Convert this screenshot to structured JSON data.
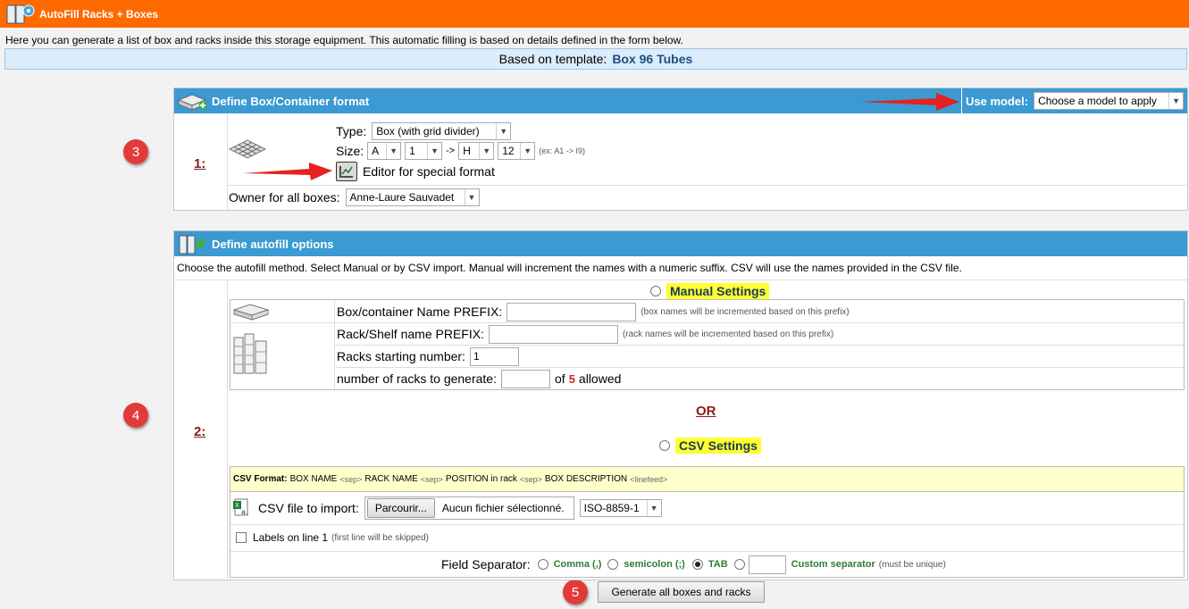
{
  "window": {
    "title": "AutoFill Racks + Boxes"
  },
  "intro": "Here you can generate a list of box and racks inside this storage equipment. This automatic filling is based on details defined in the form below.",
  "template": {
    "label": "Based on template:",
    "name": "Box 96 Tubes"
  },
  "section1": {
    "title": "Define Box/Container format",
    "use_model_label": "Use model:",
    "use_model_value": "Choose a model to apply",
    "step": "1:",
    "type_label": "Type:",
    "type_value": "Box (with grid divider)",
    "size_label": "Size:",
    "size_row_from": "A",
    "size_col_from": "1",
    "size_arrow": "->",
    "size_row_to": "H",
    "size_col_to": "12",
    "size_hint": "(ex: A1 -> I9)",
    "editor_label": "Editor for special format",
    "owner_label": "Owner for all boxes:",
    "owner_value": "Anne-Laure Sauvadet"
  },
  "section2": {
    "title": "Define autofill options",
    "description": "Choose the autofill method. Select Manual or by CSV import. Manual will increment the names with a numeric suffix. CSV will use the names provided in the CSV file.",
    "step": "2:",
    "manual_label": "Manual Settings",
    "box_prefix_label": "Box/container Name PREFIX:",
    "box_prefix_value": "",
    "box_prefix_hint": "(box names will be incremented based on this prefix)",
    "rack_prefix_label": "Rack/Shelf name PREFIX:",
    "rack_prefix_value": "",
    "rack_prefix_hint": "(rack names will be incremented based on this prefix)",
    "rack_start_label": "Racks starting number:",
    "rack_start_value": "1",
    "rack_count_label": "number of racks to generate:",
    "rack_count_value": "",
    "rack_count_of": "of",
    "rack_count_max": "5",
    "rack_count_allowed": "allowed",
    "or_label": "OR",
    "csv_label": "CSV Settings",
    "csv_format_label": "CSV Format:",
    "csv_format_1": "BOX NAME",
    "csv_sep": "<sep>",
    "csv_format_2": "RACK NAME",
    "csv_format_3": "POSITION in rack",
    "csv_format_4": "BOX DESCRIPTION",
    "csv_linefeed": "<linefeed>",
    "csv_file_label": "CSV file to import:",
    "browse_label": "Parcourir...",
    "no_file_label": "Aucun fichier sélectionné.",
    "encoding_value": "ISO-8859-1",
    "labels_line_label": "Labels on line 1",
    "labels_line_hint": "(first line will be skipped)",
    "separator_label": "Field Separator:",
    "sep_comma": "Comma (,)",
    "sep_semicolon": "semicolon (;)",
    "sep_tab": "TAB",
    "sep_custom": "Custom separator",
    "sep_custom_hint": "(must be unique)"
  },
  "generate_label": "Generate all boxes and racks",
  "annotations": {
    "c3": "3",
    "c4": "4",
    "c5": "5"
  },
  "colors": {
    "titlebar": "#ff6a00",
    "panel_header": "#3a9ad1",
    "annotation": "#e23a3a",
    "highlight": "#ffff33"
  }
}
